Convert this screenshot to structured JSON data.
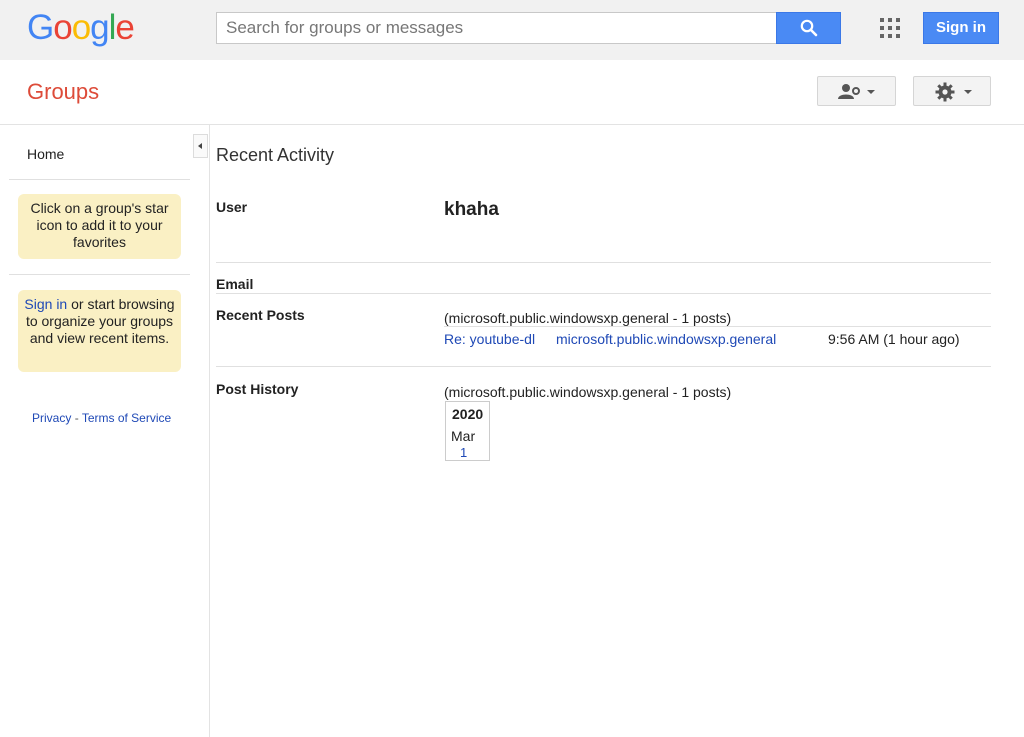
{
  "logo": {
    "text": "Google",
    "letters": [
      "G",
      "o",
      "o",
      "g",
      "l",
      "e"
    ],
    "colors": [
      "#4285f4",
      "#ea4335",
      "#fbbc05",
      "#4285f4",
      "#34a853",
      "#ea4335"
    ]
  },
  "search": {
    "placeholder": "Search for groups or messages",
    "value": ""
  },
  "header": {
    "signin_label": "Sign in",
    "groups_title": "Groups"
  },
  "sidebar": {
    "home_label": "Home",
    "favorites_tip": "Click on a group's star icon to add it to your favorites",
    "signin_tip_link": "Sign in",
    "signin_tip_rest": "or start browsing to organize your groups and view recent items.",
    "privacy_label": "Privacy",
    "separator": "-",
    "terms_label": "Terms of Service"
  },
  "main": {
    "title": "Recent Activity",
    "user_label": "User",
    "username": "khaha",
    "email_label": "Email",
    "recent_posts_label": "Recent Posts",
    "recent_posts_summary": "(microsoft.public.windowsxp.general - 1 posts)",
    "post": {
      "subject": "Re: youtube-dl",
      "group": "microsoft.public.windowsxp.general",
      "time": "9:56 AM (1 hour ago)"
    },
    "post_history_label": "Post History",
    "post_history_summary": "(microsoft.public.windowsxp.general - 1 posts)",
    "history": {
      "year": "2020",
      "month": "Mar",
      "count": "1"
    }
  },
  "colors": {
    "accent_blue": "#4a8af4",
    "groups_red": "#dd4b39",
    "link_blue": "#1f49b6",
    "tip_bg": "#faf0c4"
  }
}
